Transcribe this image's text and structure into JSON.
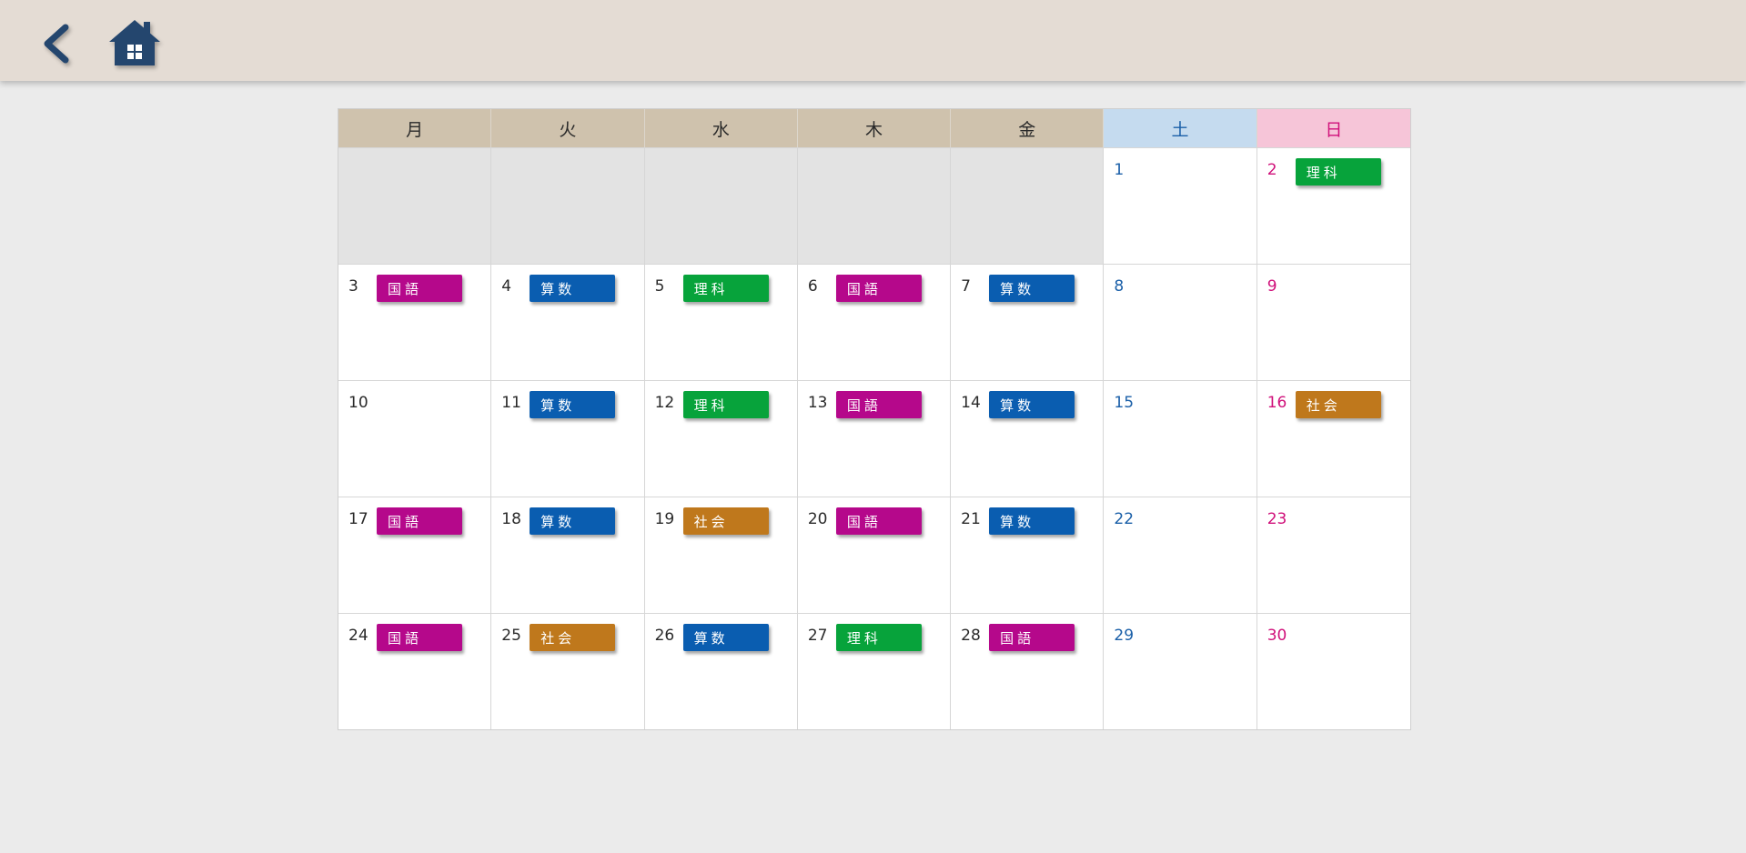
{
  "nav": {
    "back_icon": "chevron-left-icon",
    "home_icon": "home-icon",
    "icon_color": "#24466e"
  },
  "weekdays": [
    "月",
    "火",
    "水",
    "木",
    "金",
    "土",
    "日"
  ],
  "subject_colors": {
    "国語": "#b5088b",
    "算数": "#0a5db0",
    "理科": "#07a33b",
    "社会": "#bf781c"
  },
  "weeks": [
    [
      null,
      null,
      null,
      null,
      null,
      {
        "day": "1",
        "subject": null
      },
      {
        "day": "2",
        "subject": "理科"
      }
    ],
    [
      {
        "day": "3",
        "subject": "国語"
      },
      {
        "day": "4",
        "subject": "算数"
      },
      {
        "day": "5",
        "subject": "理科"
      },
      {
        "day": "6",
        "subject": "国語"
      },
      {
        "day": "7",
        "subject": "算数"
      },
      {
        "day": "8",
        "subject": null
      },
      {
        "day": "9",
        "subject": null
      }
    ],
    [
      {
        "day": "10",
        "subject": null
      },
      {
        "day": "11",
        "subject": "算数"
      },
      {
        "day": "12",
        "subject": "理科"
      },
      {
        "day": "13",
        "subject": "国語"
      },
      {
        "day": "14",
        "subject": "算数"
      },
      {
        "day": "15",
        "subject": null
      },
      {
        "day": "16",
        "subject": "社会"
      }
    ],
    [
      {
        "day": "17",
        "subject": "国語"
      },
      {
        "day": "18",
        "subject": "算数"
      },
      {
        "day": "19",
        "subject": "社会"
      },
      {
        "day": "20",
        "subject": "国語"
      },
      {
        "day": "21",
        "subject": "算数"
      },
      {
        "day": "22",
        "subject": null
      },
      {
        "day": "23",
        "subject": null
      }
    ],
    [
      {
        "day": "24",
        "subject": "国語"
      },
      {
        "day": "25",
        "subject": "社会"
      },
      {
        "day": "26",
        "subject": "算数"
      },
      {
        "day": "27",
        "subject": "理科"
      },
      {
        "day": "28",
        "subject": "国語"
      },
      {
        "day": "29",
        "subject": null
      },
      {
        "day": "30",
        "subject": null
      }
    ]
  ]
}
